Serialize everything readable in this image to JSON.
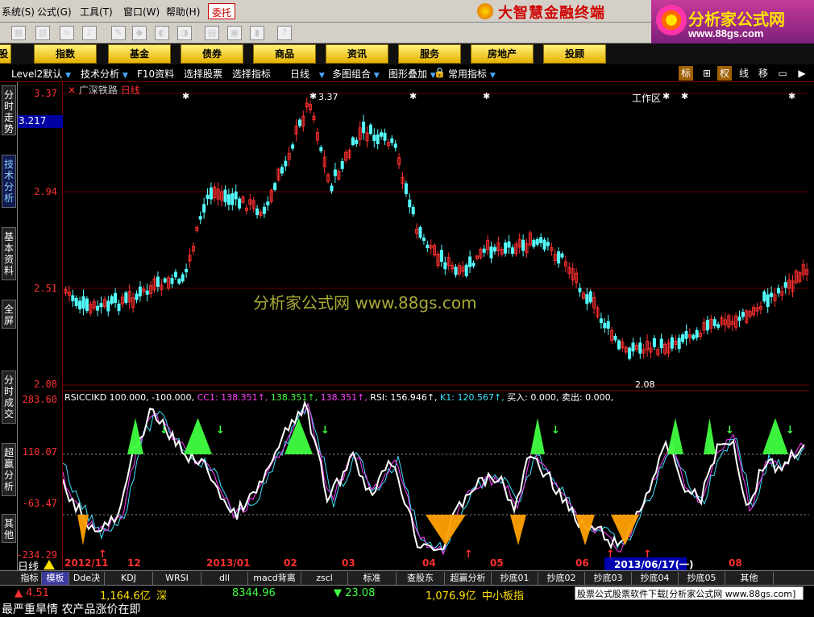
{
  "menubar": {
    "items": [
      "系统(S)",
      "公式(G)",
      "工具(T)",
      "窗口(W)",
      "帮助(H)"
    ],
    "entrust": "委托",
    "brand": "大智慧金融终端"
  },
  "corner_logo": {
    "title": "分析家公式网",
    "url": "www.88gs.com"
  },
  "nav": {
    "buttons": [
      "股",
      "指数",
      "基金",
      "债券",
      "商品",
      "资讯",
      "服务",
      "房地产",
      "投顾"
    ],
    "workarea": "工作区"
  },
  "subbar": {
    "items": [
      "Level2默认",
      "技术分析",
      "F10资料",
      "选择股票",
      "选择指标",
      "日线",
      "多图组合",
      "图形叠加",
      "常用指标"
    ],
    "tools": [
      "标",
      "权",
      "线",
      "移"
    ]
  },
  "sidebar": {
    "tabs": [
      "分时走势",
      "技术分析",
      "基本资料",
      "全屏",
      "分时成交",
      "超赢分析",
      "其他"
    ]
  },
  "main_chart": {
    "stock_name": "广深铁路",
    "period": "日线",
    "price_axis": [
      "3.37",
      "2.94",
      "2.51",
      "2.08"
    ],
    "current_price": "3.217",
    "high_label": "3.37",
    "low_label": "2.08",
    "watermark": "分析家公式网 www.88gs.com"
  },
  "indicator": {
    "name": "RSICCIKD",
    "values": [
      {
        "text": "100.000,",
        "color": "#ffffff"
      },
      {
        "text": "-100.000,",
        "color": "#ffffff"
      },
      {
        "text": "CC1: 138.351↑,",
        "color": "#ff40ff"
      },
      {
        "text": "138.351↑,",
        "color": "#40ff40"
      },
      {
        "text": "138.351↑,",
        "color": "#ff40ff"
      },
      {
        "text": "RSI: 156.946↑,",
        "color": "#ffffff"
      },
      {
        "text": "K1: 120.567↑,",
        "color": "#40e0ff"
      },
      {
        "text": "买入: 0.000,",
        "color": "#ffffff"
      },
      {
        "text": "卖出: 0.000,",
        "color": "#ffffff"
      }
    ],
    "axis": [
      "283.60",
      "110.07",
      "-63.47",
      "-234.29"
    ]
  },
  "date_axis": {
    "labels": [
      "2012/11",
      "12",
      "2013/01",
      "02",
      "03",
      "04",
      "05",
      "06",
      "08"
    ],
    "cursor_date": "2013/06/17(一)",
    "period_label": "日线"
  },
  "ind_tabs": [
    "指标",
    "模板",
    "Dde决策",
    "KDJ",
    "WRSI",
    "dll",
    "macd背离",
    "zscl",
    "标准",
    "查股东",
    "超赢分析",
    "抄底01",
    "抄底02",
    "抄底03",
    "抄底04",
    "抄底05",
    "其他"
  ],
  "status": {
    "sh_change": "▲ 4.51",
    "sh_amount": "1,164.6亿",
    "sz_label": "深",
    "sz_index": "8344.96",
    "sz_change": "▼ 23.08",
    "sz_amount": "1,076.9亿",
    "board": "中小板指",
    "ad": "股票公式股票软件下载[分析家公式网 www.88gs.com]"
  },
  "ticker": "最严重旱情 农产品涨价在即"
}
